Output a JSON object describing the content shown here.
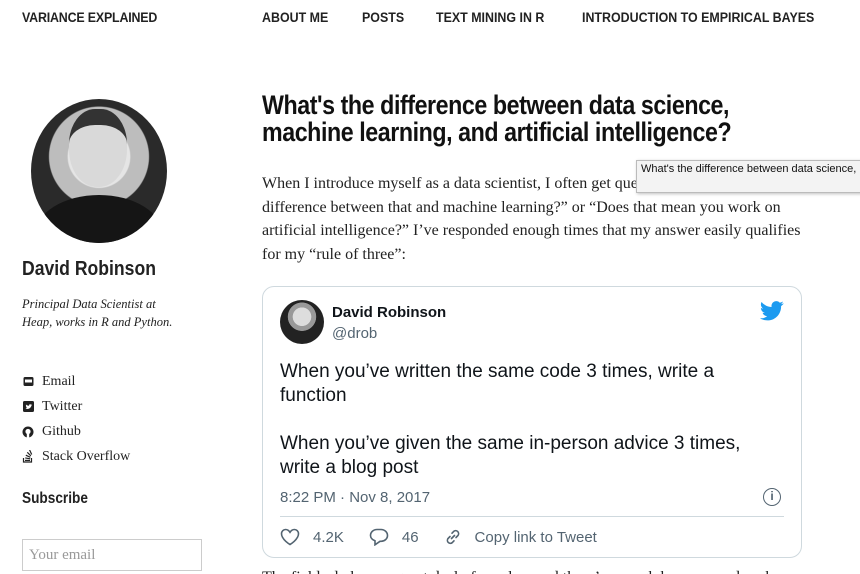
{
  "site": {
    "brand": "VARIANCE EXPLAINED"
  },
  "nav": [
    {
      "label": "ABOUT ME"
    },
    {
      "label": "POSTS"
    },
    {
      "label": "TEXT MINING IN R"
    },
    {
      "label": "INTRODUCTION TO EMPIRICAL BAYES"
    }
  ],
  "sidebar": {
    "name": "David Robinson",
    "bio": "Principal Data Scientist at Heap, works in R and Python.",
    "links": [
      {
        "label": "Email",
        "icon": "envelope-icon"
      },
      {
        "label": "Twitter",
        "icon": "twitter-icon"
      },
      {
        "label": "Github",
        "icon": "github-icon"
      },
      {
        "label": "Stack Overflow",
        "icon": "stack-overflow-icon"
      }
    ],
    "subscribe_heading": "Subscribe",
    "email_placeholder": "Your email"
  },
  "post": {
    "title": "What's the difference between data science, machine learning, and artificial intelligence?",
    "intro": "When I introduce myself as a data scientist, I often get questions like “What’s the difference between that and machine learning?” or “Does that mean you work on artificial intelligence?” I’ve responded enough times that my answer easily qualifies for my “rule of three”:",
    "tooltip": "What's the difference between data science, machine learning, and artificial intelligence?",
    "tail": "The fields do have a great deal of overlap, and there’s enough hype around each"
  },
  "tweet": {
    "author_name": "David Robinson",
    "handle": "@drob",
    "text_1": "When you’ve written the same code 3 times, write a function",
    "text_2": "When you’ve given the same in-person advice 3 times, write a blog post",
    "timestamp": "8:22 PM · Nov 8, 2017",
    "likes": "4.2K",
    "replies": "46",
    "copy_link": "Copy link to Tweet",
    "brand_color": "#1d9bf0"
  }
}
